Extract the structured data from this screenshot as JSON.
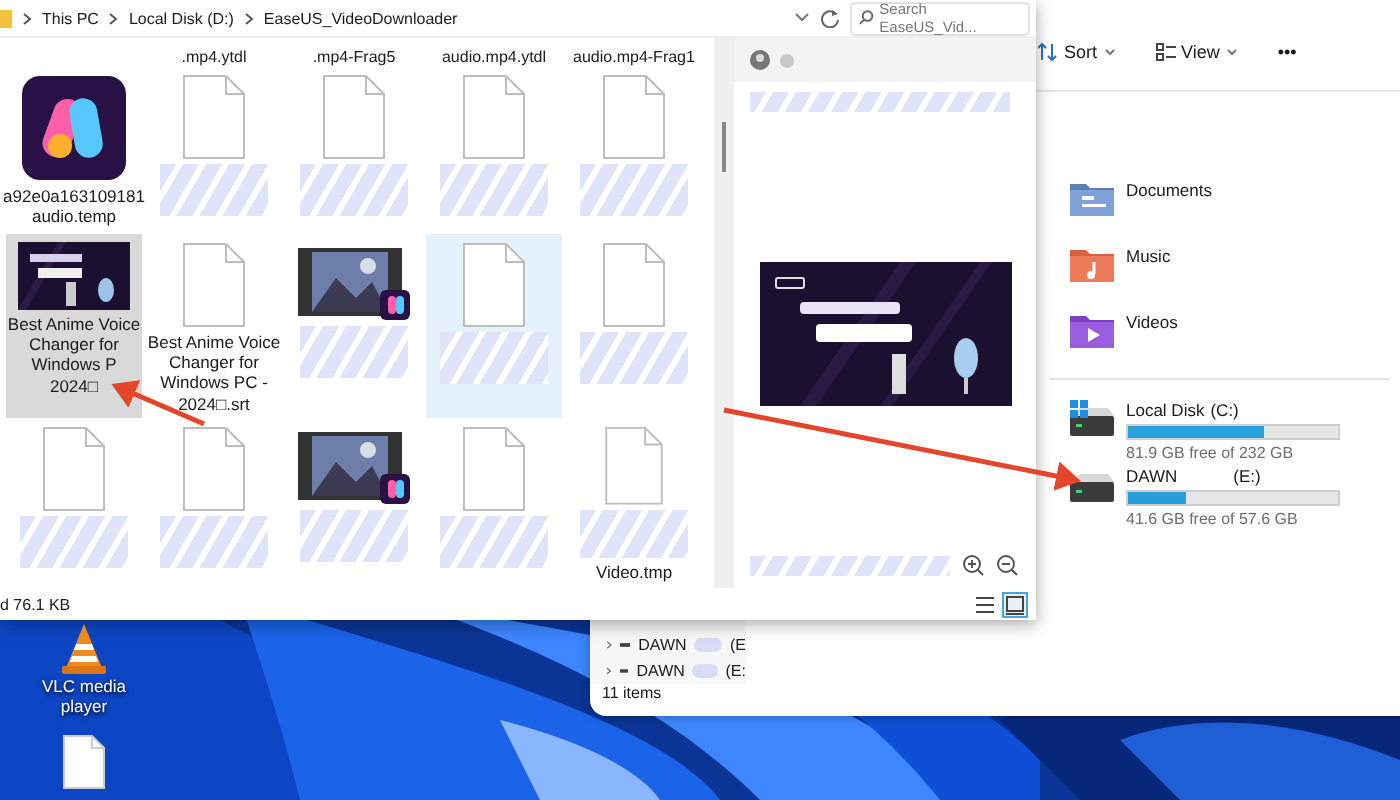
{
  "front_window": {
    "breadcrumb": [
      "This PC",
      "Local Disk (D:)",
      "EaseUS_VideoDownloader"
    ],
    "search": {
      "placeholder": "Search EaseUS_Vid..."
    },
    "cut_row_labels": [
      ".mp4.ytdl",
      ".mp4-Frag5",
      "audio.mp4.ytdl",
      "audio.mp4-Frag1"
    ],
    "files": [
      {
        "kind": "app",
        "label": "a92e0a163109181 audio.temp",
        "selected": false,
        "hover": false,
        "redacted": false
      },
      {
        "kind": "document",
        "selected": false,
        "hover": false,
        "redacted": true
      },
      {
        "kind": "document",
        "selected": false,
        "hover": false,
        "redacted": true
      },
      {
        "kind": "document",
        "selected": false,
        "hover": false,
        "redacted": true
      },
      {
        "kind": "document",
        "selected": false,
        "hover": false,
        "redacted": true
      },
      {
        "label": "Best Anime Voice\nChanger for\nWindows P\n2024□",
        "selected": true,
        "hover": false,
        "redacted": false
      },
      {
        "kind": "document",
        "label": "Best Anime Voice\nChanger for\nWindows PC -\n2024□.srt",
        "selected": false,
        "hover": false,
        "redacted": false
      },
      {
        "kind": "video",
        "selected": false,
        "hover": false,
        "redacted": true
      },
      {
        "kind": "document",
        "selected": false,
        "hover": true,
        "redacted": true
      },
      {
        "kind": "document",
        "selected": false,
        "hover": false,
        "redacted": true
      },
      {
        "kind": "document",
        "selected": false,
        "hover": false,
        "redacted": true
      },
      {
        "kind": "document",
        "selected": false,
        "hover": false,
        "redacted": true
      },
      {
        "kind": "video",
        "selected": false,
        "hover": false,
        "redacted": true
      },
      {
        "kind": "document",
        "selected": false,
        "hover": false,
        "redacted": true
      },
      {
        "kind": "document",
        "label": "Video.tmp",
        "selected": false,
        "hover": false,
        "redacted": true
      }
    ],
    "preview": {
      "header_redacted": true,
      "footer_redacted": true,
      "view_buttons": [
        {
          "kind": "details",
          "selected": false
        },
        {
          "kind": "large-icons",
          "selected": true
        }
      ]
    },
    "status_bar": "d  76.1 KB"
  },
  "back_window": {
    "toolbar": [
      {
        "kind": "sort",
        "label": "Sort"
      },
      {
        "kind": "view",
        "label": "View"
      },
      {
        "kind": "more",
        "label": "•••"
      }
    ],
    "folders": [
      {
        "kind": "documents",
        "label": "Documents"
      },
      {
        "kind": "music",
        "label": "Music"
      },
      {
        "kind": "videos",
        "label": "Videos"
      }
    ],
    "drives": [
      {
        "kind": "system",
        "name": "Local Disk",
        "letter": "(C:)",
        "redacted": false,
        "level": 0.647,
        "free": "81.9 GB free of 232 GB"
      },
      {
        "kind": "removable",
        "name": "DAWN",
        "letter": "(E:)",
        "redacted": true,
        "level": 0.278,
        "free": "41.6 GB free of 57.6 GB"
      }
    ],
    "nav_items": [
      {
        "label": "DAWN",
        "drive": "(E",
        "redacted": true
      },
      {
        "label": "DAWN",
        "drive": "(E:",
        "redacted": true
      }
    ],
    "status_bar": "11 items"
  },
  "desktop_icons": [
    {
      "kind": "vlc",
      "label": "VLC media player"
    },
    {
      "kind": "document"
    }
  ]
}
